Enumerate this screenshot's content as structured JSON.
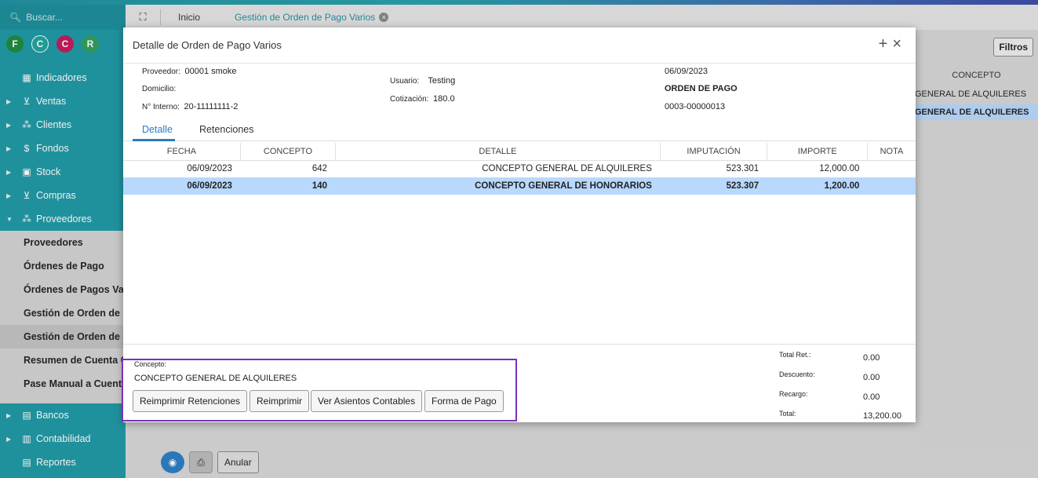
{
  "app": {
    "search_placeholder": "Buscar...",
    "avatars": [
      {
        "letter": "F",
        "color": "#1a8a3c"
      },
      {
        "letter": "C",
        "color": "#1ba39c"
      },
      {
        "letter": "C",
        "color": "#c2185b"
      },
      {
        "letter": "R",
        "color": "#2e9e5b"
      }
    ],
    "tabs": {
      "inicio": "Inicio",
      "active": "Gestión de Orden de Pago Varios"
    }
  },
  "sidebar": {
    "items": [
      {
        "label": "Indicadores",
        "icon": "▦"
      },
      {
        "label": "Ventas",
        "icon": "🛒"
      },
      {
        "label": "Clientes",
        "icon": "👥"
      },
      {
        "label": "Fondos",
        "icon": "$"
      },
      {
        "label": "Stock",
        "icon": "▣"
      },
      {
        "label": "Compras",
        "icon": "🛒"
      },
      {
        "label": "Proveedores",
        "icon": "👥"
      }
    ],
    "sub": [
      "Proveedores",
      "Órdenes de Pago",
      "Órdenes de Pagos Varios",
      "Gestión de Orden de Pago",
      "Gestión de Orden de Pago",
      "Resumen de Cuenta Corr",
      "Pase Manual a Cuenta C"
    ],
    "bottom": [
      {
        "label": "Bancos"
      },
      {
        "label": "Contabilidad"
      },
      {
        "label": "Reportes"
      }
    ]
  },
  "right": {
    "filtros": "Filtros",
    "head": "CONCEPTO",
    "rows": [
      "GENERAL DE ALQUILERES",
      "GENERAL DE ALQUILERES"
    ]
  },
  "bottom": {
    "anular": "Anular"
  },
  "modal": {
    "title": "Detalle de Orden de Pago Varios",
    "proveedor_label": "Proveedor:",
    "proveedor": "00001 smoke",
    "domicilio_label": "Domicilio:",
    "interno_label": "N° Interno:",
    "interno": "20-11111111-2",
    "usuario_label": "Usuario:",
    "usuario": "Testing",
    "cotizacion_label": "Cotización:",
    "cotizacion": "180.0",
    "fecha": "06/09/2023",
    "tipo": "ORDEN DE PAGO",
    "numero": "0003-00000013",
    "tab_detalle": "Detalle",
    "tab_retenciones": "Retenciones",
    "columns": [
      "FECHA",
      "CONCEPTO",
      "DETALLE",
      "IMPUTACIÓN",
      "IMPORTE",
      "NOTA"
    ],
    "rows": [
      {
        "fecha": "06/09/2023",
        "concepto": "642",
        "detalle": "CONCEPTO GENERAL DE ALQUILERES",
        "imputacion": "523.301",
        "importe": "12,000.00",
        "nota": ""
      },
      {
        "fecha": "06/09/2023",
        "concepto": "140",
        "detalle": "CONCEPTO GENERAL DE HONORARIOS",
        "imputacion": "523.307",
        "importe": "1,200.00",
        "nota": ""
      }
    ],
    "concepto_label": "Concepto:",
    "concepto_value": "CONCEPTO GENERAL DE ALQUILERES",
    "buttons": {
      "reimprimir_ret": "Reimprimir Retenciones",
      "reimprimir": "Reimprimir",
      "asientos": "Ver Asientos Contables",
      "forma_pago": "Forma de Pago"
    },
    "totals": {
      "ret_label": "Total Ret.:",
      "ret": "0.00",
      "desc_label": "Descuento:",
      "desc": "0.00",
      "rec_label": "Recargo:",
      "rec": "0.00",
      "total_label": "Total:",
      "total": "13,200.00"
    }
  }
}
